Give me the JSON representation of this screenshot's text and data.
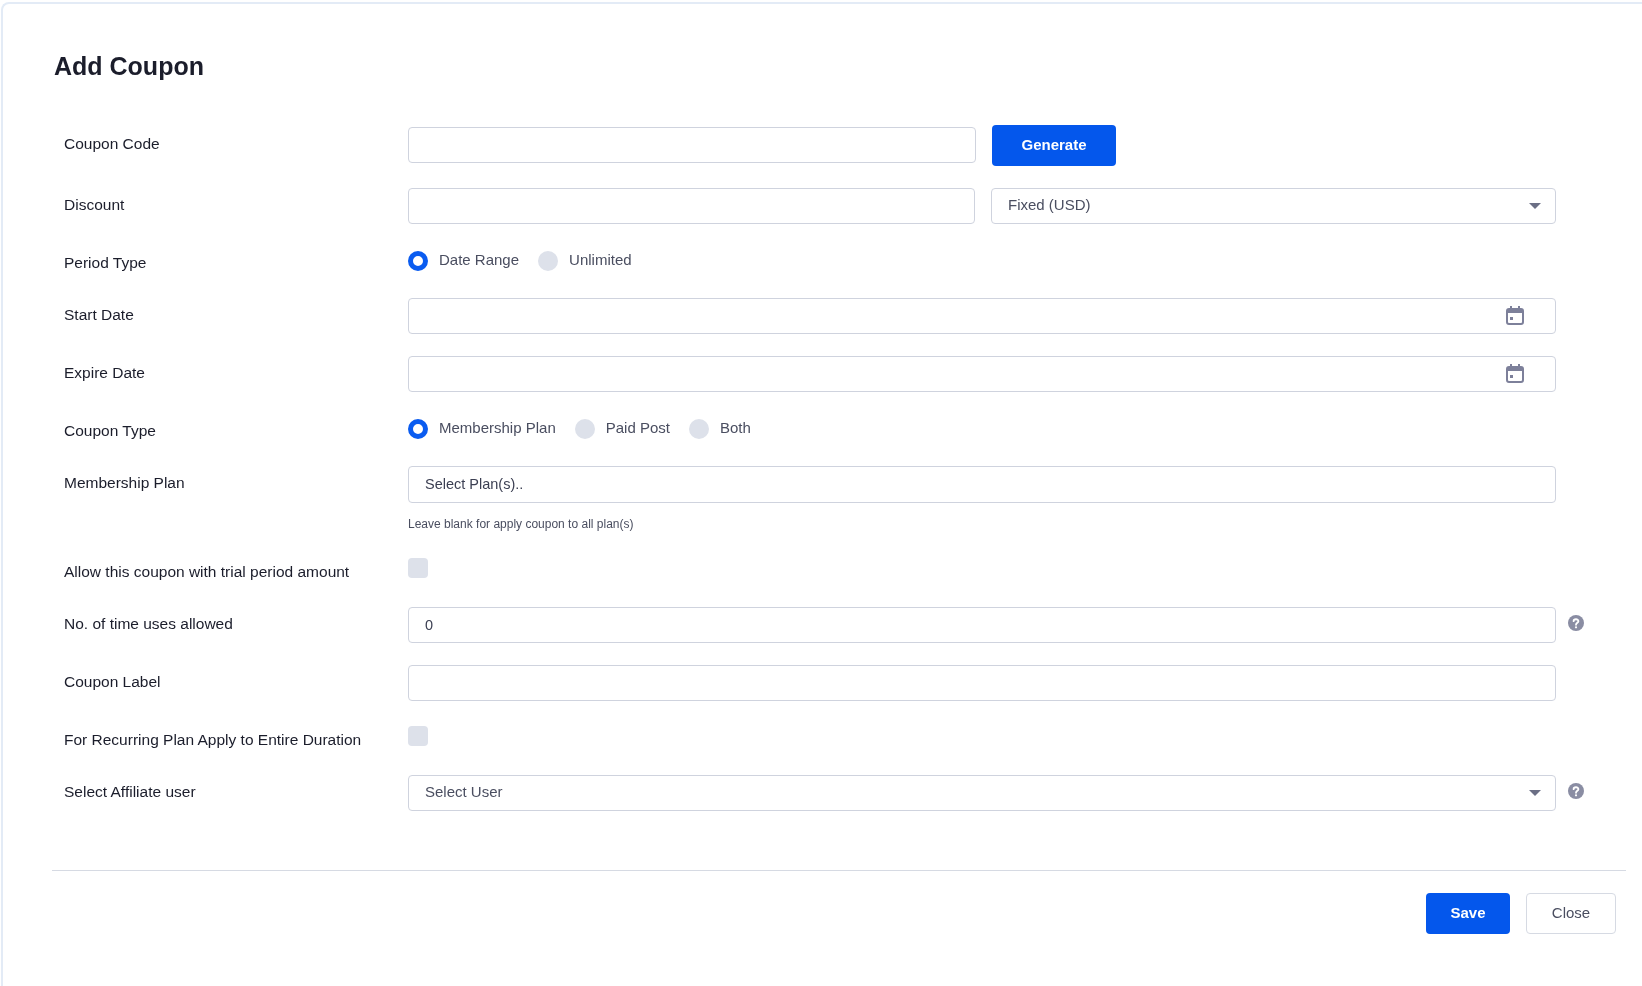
{
  "title": "Add Coupon",
  "fields": [
    {
      "kind": "input_button",
      "label": "Coupon Code",
      "button": "Generate"
    },
    {
      "kind": "input_select",
      "label": "Discount",
      "select_value": "Fixed (USD)"
    },
    {
      "kind": "radio",
      "label": "Period Type",
      "options": [
        {
          "label": "Date Range",
          "selected": true
        },
        {
          "label": "Unlimited",
          "selected": false
        }
      ]
    },
    {
      "kind": "date",
      "label": "Start Date"
    },
    {
      "kind": "date",
      "label": "Expire Date"
    },
    {
      "kind": "radio",
      "label": "Coupon Type",
      "options": [
        {
          "label": "Membership Plan",
          "selected": true
        },
        {
          "label": "Paid Post",
          "selected": false
        },
        {
          "label": "Both",
          "selected": false
        }
      ]
    },
    {
      "kind": "multiselect",
      "label": "Membership Plan",
      "placeholder": "Select Plan(s)..",
      "help": "Leave blank for apply coupon to all plan(s)"
    },
    {
      "kind": "checkbox",
      "label": "Allow this coupon with trial period amount",
      "checked": false
    },
    {
      "kind": "input",
      "label": "No. of time uses allowed",
      "value": "0",
      "help_icon": true
    },
    {
      "kind": "input",
      "label": "Coupon Label"
    },
    {
      "kind": "checkbox",
      "label": "For Recurring Plan Apply to Entire Duration",
      "checked": false
    },
    {
      "kind": "select",
      "label": "Select Affiliate user",
      "value": "Select User",
      "help_icon": true
    }
  ],
  "buttons": [
    {
      "label": "Save",
      "kind": "primary"
    },
    {
      "label": "Close",
      "kind": "secondary"
    }
  ]
}
